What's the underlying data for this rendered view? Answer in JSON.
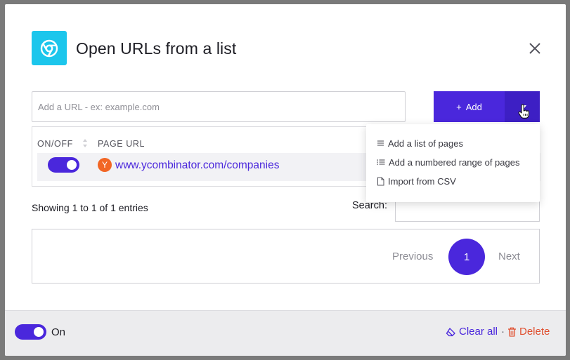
{
  "dialog": {
    "title": "Open URLs from a list",
    "app_icon": "chrome-icon",
    "close_icon": "close-icon"
  },
  "url_input": {
    "placeholder": "Add a URL - ex: example.com",
    "value": ""
  },
  "add_button": {
    "label": "Add",
    "icon": "plus-icon",
    "caret_icon": "caret-down-icon"
  },
  "add_menu": {
    "items": [
      {
        "label": "Add a list of pages",
        "icon": "list-icon"
      },
      {
        "label": "Add a numbered range of pages",
        "icon": "numbered-list-icon"
      },
      {
        "label": "Import from CSV",
        "icon": "file-icon"
      }
    ]
  },
  "table": {
    "columns": [
      "ON/OFF",
      "PAGE URL"
    ],
    "rows": [
      {
        "enabled": true,
        "favicon_letter": "Y",
        "url": "www.ycombinator.com/companies"
      }
    ]
  },
  "info": {
    "showing": "Showing 1 to 1 of 1 entries"
  },
  "search": {
    "label": "Search:",
    "value": ""
  },
  "pagination": {
    "previous": "Previous",
    "current_page": "1",
    "next": "Next"
  },
  "footer": {
    "enabled": true,
    "on_label": "On",
    "clear_all": "Clear all",
    "separator": "·",
    "delete": "Delete"
  },
  "colors": {
    "accent": "#4a27dc",
    "app_icon_bg": "#1cc6ec",
    "delete": "#e04f2f",
    "favicon": "#f26625"
  }
}
